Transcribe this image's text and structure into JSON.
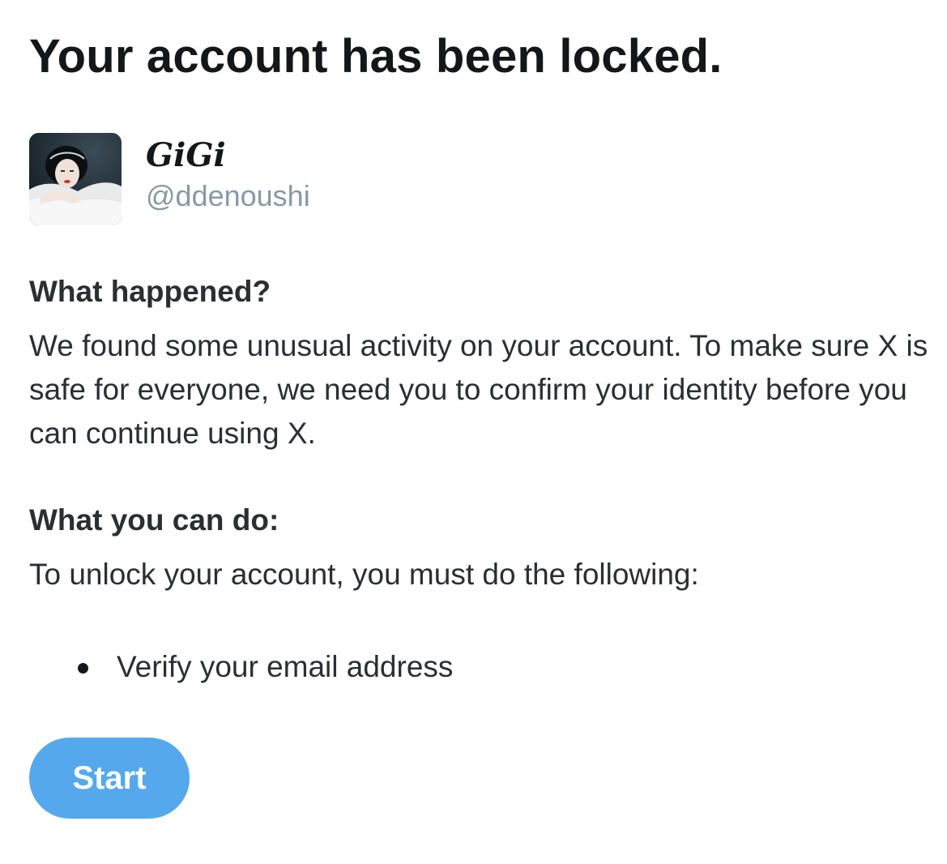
{
  "page": {
    "title": "Your account has been locked."
  },
  "account": {
    "display_name": "GiGi",
    "handle": "@ddenoushi",
    "avatar_icon": "user-avatar-photo"
  },
  "sections": {
    "what_happened": {
      "heading": "What happened?",
      "body": "We found some unusual activity on your account. To make sure X is safe for everyone, we need you to confirm your identity before you can continue using X."
    },
    "what_you_can_do": {
      "heading": "What you can do:",
      "body": "To unlock your account, you must do the following:",
      "steps": [
        "Verify your email address"
      ]
    }
  },
  "actions": {
    "start_label": "Start"
  },
  "colors": {
    "accent": "#55a8ec",
    "text_primary": "#14171a",
    "text_secondary": "#8899a6"
  }
}
